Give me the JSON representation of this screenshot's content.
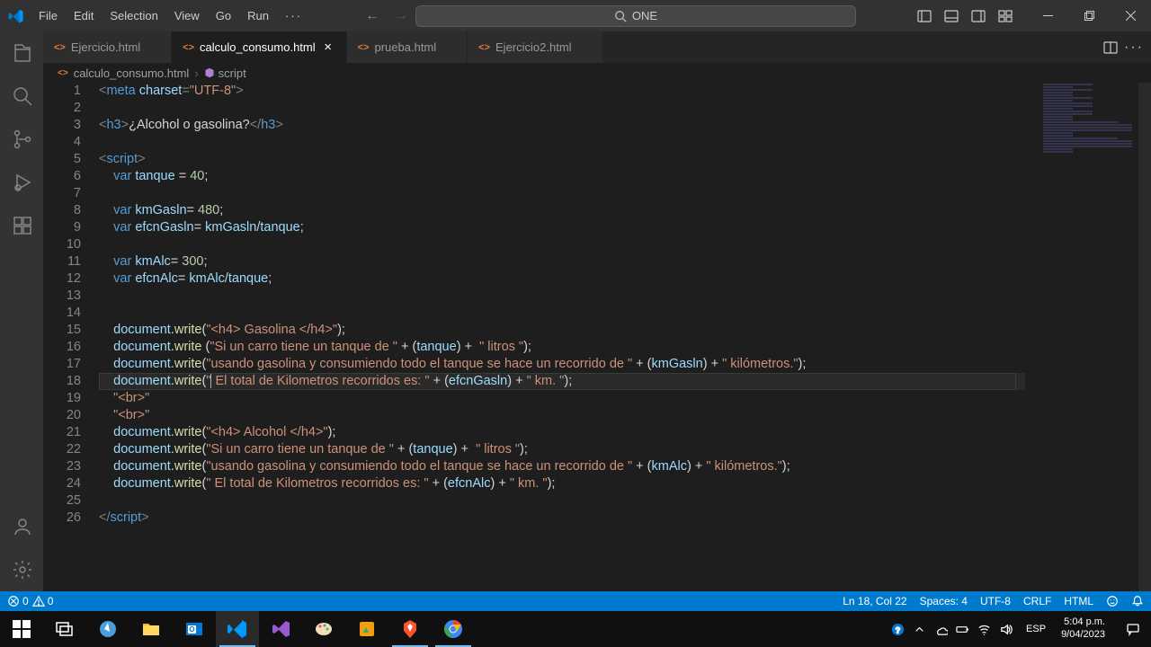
{
  "titlebar": {
    "menu": [
      "File",
      "Edit",
      "Selection",
      "View",
      "Go",
      "Run"
    ],
    "search": "ONE"
  },
  "tabs": [
    {
      "name": "Ejercicio.html",
      "active": false
    },
    {
      "name": "calculo_consumo.html",
      "active": true
    },
    {
      "name": "prueba.html",
      "active": false
    },
    {
      "name": "Ejercicio2.html",
      "active": false
    }
  ],
  "breadcrumbs": {
    "file": "calculo_consumo.html",
    "symbol": "script"
  },
  "code": {
    "lines": 26,
    "highlight": 18
  },
  "status": {
    "errors": "0",
    "warnings": "0",
    "position": "Ln 18, Col 22",
    "spaces": "Spaces: 4",
    "encoding": "UTF-8",
    "eol": "CRLF",
    "language": "HTML"
  },
  "taskbar": {
    "lang": "ESP",
    "time": "5:04 p.m.",
    "date": "9/04/2023"
  }
}
